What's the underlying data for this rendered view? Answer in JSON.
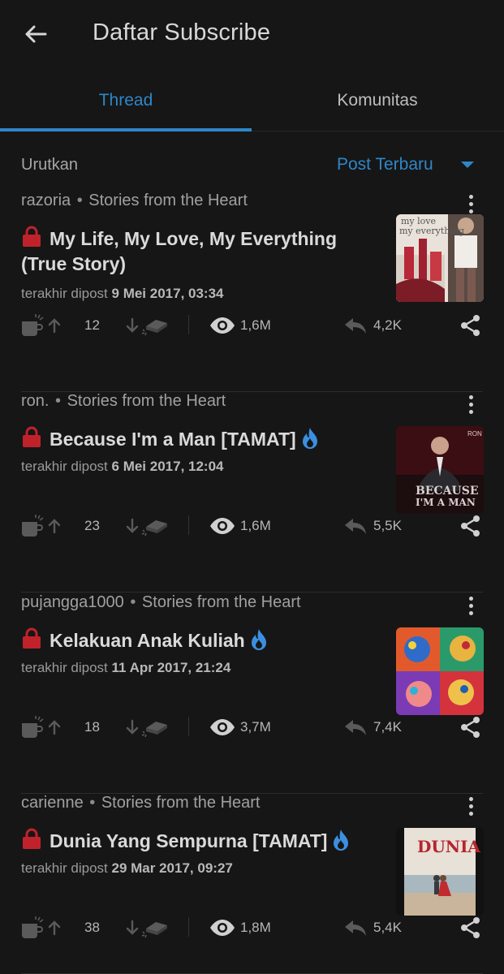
{
  "header": {
    "title": "Daftar Subscribe"
  },
  "tabs": [
    {
      "label": "Thread",
      "active": true
    },
    {
      "label": "Komunitas",
      "active": false
    }
  ],
  "sort": {
    "label": "Urutkan",
    "value": "Post Terbaru"
  },
  "colors": {
    "accent": "#2f86c8",
    "lock": "#c0222b",
    "fire": "#3b8fe0",
    "background": "#161616"
  },
  "threads": [
    {
      "author": "razoria",
      "community": "Stories from the Heart",
      "title": "My Life, My Love, My Everything (True Story)",
      "hot": false,
      "posted_prefix": "terakhir dipost",
      "posted_date": "9 Mei 2017, 03:34",
      "upvotes": "12",
      "views": "1,6M",
      "replies": "4,2K",
      "thumb_text": "my love my everything"
    },
    {
      "author": "ron.",
      "community": "Stories from the Heart",
      "title": "Because I'm a Man [TAMAT]",
      "hot": true,
      "posted_prefix": "terakhir dipost",
      "posted_date": "6 Mei 2017, 12:04",
      "upvotes": "23",
      "views": "1,6M",
      "replies": "5,5K",
      "thumb_text": "BECAUSE I'M A MAN"
    },
    {
      "author": "pujangga1000",
      "community": "Stories from the Heart",
      "title": "Kelakuan Anak Kuliah",
      "hot": true,
      "posted_prefix": "terakhir dipost",
      "posted_date": "11 Apr 2017, 21:24",
      "upvotes": "18",
      "views": "3,7M",
      "replies": "7,4K",
      "thumb_text": ""
    },
    {
      "author": "carienne",
      "community": "Stories from the Heart",
      "title": "Dunia Yang Sempurna [TAMAT]",
      "hot": true,
      "posted_prefix": "terakhir dipost",
      "posted_date": "29 Mar 2017, 09:27",
      "upvotes": "38",
      "views": "1,8M",
      "replies": "5,4K",
      "thumb_text": "DUNIA"
    }
  ]
}
